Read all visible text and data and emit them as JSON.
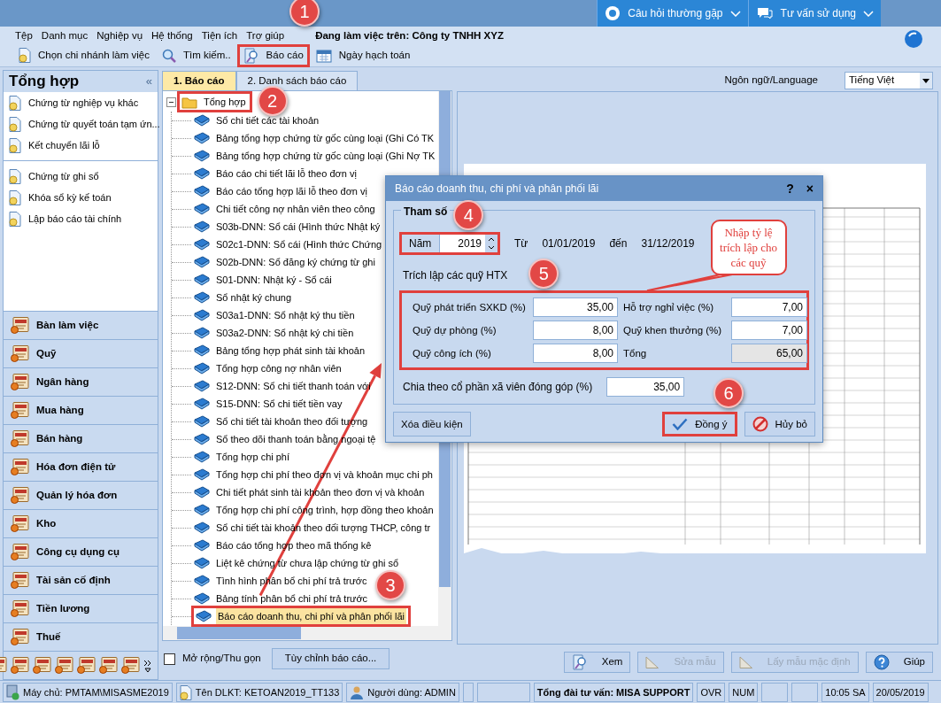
{
  "title_bar": {
    "buttons": [
      {
        "label": "Câu hỏi thường gặp"
      },
      {
        "label": "Tư vấn sử dụng"
      }
    ]
  },
  "menu": {
    "items": [
      "Tệp",
      "Danh mục",
      "Nghiệp vụ",
      "Hệ thống",
      "Tiện ích",
      "Trợ giúp"
    ],
    "working_on": "Đang làm việc trên:  Công ty TNHH XYZ"
  },
  "toolbar": {
    "items": [
      {
        "label": "Chọn chi nhánh làm việc",
        "highlighted": false
      },
      {
        "label": "Tìm kiếm..",
        "highlighted": false
      },
      {
        "label": "Báo cáo",
        "highlighted": true
      },
      {
        "label": "Ngày hạch toán",
        "highlighted": false
      }
    ]
  },
  "sidebar": {
    "title": "Tổng hợp",
    "collapse_glyph": "«",
    "item_groups": [
      {
        "items": [
          "Chứng từ nghiệp vụ khác",
          "Chứng từ quyết toán tạm ứn...",
          "Kết chuyển lãi lỗ"
        ]
      },
      {
        "items": [
          "Chứng từ ghi sổ",
          "Khóa sổ kỳ kế toán",
          "Lập báo cáo tài chính"
        ]
      }
    ],
    "modules": [
      "Bàn làm việc",
      "Quỹ",
      "Ngân hàng",
      "Mua hàng",
      "Bán hàng",
      "Hóa đơn điện tử",
      "Quản lý hóa đơn",
      "Kho",
      "Công cụ dụng cụ",
      "Tài sản cố định",
      "Tiền lương",
      "Thuế"
    ]
  },
  "tabs": [
    {
      "label": "1. Báo cáo",
      "selected": true
    },
    {
      "label": "2. Danh sách báo cáo",
      "selected": false
    }
  ],
  "tree": {
    "label": "Tổng hợp",
    "expanded": true,
    "highlighted": true,
    "children": [
      {
        "label": "Sổ chi tiết các tài khoản",
        "selected": false,
        "highlighted": false
      },
      {
        "label": "Bảng tổng hợp chứng từ gốc cùng loại (Ghi Có TK",
        "selected": false,
        "highlighted": false
      },
      {
        "label": "Bảng tổng hợp chứng từ gốc cùng loại (Ghi Nợ TK",
        "selected": false,
        "highlighted": false
      },
      {
        "label": "Báo cáo chi tiết lãi lỗ theo đơn vị",
        "selected": false,
        "highlighted": false
      },
      {
        "label": "Báo cáo tổng hợp lãi lỗ theo đơn vị",
        "selected": false,
        "highlighted": false
      },
      {
        "label": "Chi tiết công nợ nhân viên theo công",
        "selected": false,
        "highlighted": false
      },
      {
        "label": "S03b-DNN: Sổ cái (Hình thức Nhật ký",
        "selected": false,
        "highlighted": false
      },
      {
        "label": "S02c1-DNN: Sổ cái (Hình thức Chứng",
        "selected": false,
        "highlighted": false
      },
      {
        "label": "S02b-DNN: Sổ đăng ký chứng từ ghi",
        "selected": false,
        "highlighted": false
      },
      {
        "label": "S01-DNN: Nhật ký - Sổ cái",
        "selected": false,
        "highlighted": false
      },
      {
        "label": "Sổ nhật ký chung",
        "selected": false,
        "highlighted": false
      },
      {
        "label": "S03a1-DNN: Sổ nhật ký thu tiền",
        "selected": false,
        "highlighted": false
      },
      {
        "label": "S03a2-DNN: Sổ nhật ký chi tiền",
        "selected": false,
        "highlighted": false
      },
      {
        "label": "Bảng tổng hợp phát sinh tài khoản",
        "selected": false,
        "highlighted": false
      },
      {
        "label": "Tổng hợp công nợ nhân viên",
        "selected": false,
        "highlighted": false
      },
      {
        "label": "S12-DNN: Sổ chi tiết thanh toán với",
        "selected": false,
        "highlighted": false
      },
      {
        "label": "S15-DNN: Sổ chi tiết tiền vay",
        "selected": false,
        "highlighted": false
      },
      {
        "label": "Sổ chi tiết tài khoản theo đối tượng",
        "selected": false,
        "highlighted": false
      },
      {
        "label": "Sổ theo dõi thanh toán bằng ngoại tệ",
        "selected": false,
        "highlighted": false
      },
      {
        "label": "Tổng hợp chi phí",
        "selected": false,
        "highlighted": false
      },
      {
        "label": "Tổng hợp chi phí theo đơn vị và khoản mục chi ph",
        "selected": false,
        "highlighted": false
      },
      {
        "label": "Chi tiết phát sinh tài khoản theo đơn vị và khoản",
        "selected": false,
        "highlighted": false
      },
      {
        "label": "Tổng hợp chi phí công trình, hợp đồng theo khoản",
        "selected": false,
        "highlighted": false
      },
      {
        "label": "Sổ chi tiết tài khoản theo đối tượng THCP, công tr",
        "selected": false,
        "highlighted": false
      },
      {
        "label": "Báo cáo tổng hợp theo mã thống kê",
        "selected": false,
        "highlighted": false
      },
      {
        "label": "Liệt kê chứng từ chưa lập chứng từ ghi sổ",
        "selected": false,
        "highlighted": false
      },
      {
        "label": "Tình hình phân bổ chi phí trả trước",
        "selected": false,
        "highlighted": false
      },
      {
        "label": "Bảng tính phân bổ chi phí trả trước",
        "selected": false,
        "highlighted": false
      },
      {
        "label": "Báo cáo doanh thu, chi phí và phân phối lãi",
        "selected": true,
        "highlighted": true
      }
    ]
  },
  "expand_toggle": {
    "label": "Mở rộng/Thu gọn",
    "checked": false
  },
  "customize_button": "Tùy chỉnh báo cáo...",
  "language": {
    "label": "Ngôn ngữ/Language",
    "value": "Tiếng Việt"
  },
  "preview_buttons": [
    {
      "label": "Xem",
      "disabled": false
    },
    {
      "label": "Sửa mẫu",
      "disabled": true
    },
    {
      "label": "Lấy mẫu mặc định",
      "disabled": true
    },
    {
      "label": "Giúp",
      "disabled": false
    }
  ],
  "dialog": {
    "title": "Báo cáo doanh thu, chi phí và phân phối lãi",
    "help_glyph": "?",
    "close_glyph": "×",
    "group_title": "Tham số",
    "year_label": "Năm",
    "year": "2019",
    "year_highlighted": true,
    "from_label": "Từ",
    "from": "01/01/2019",
    "to_label": "đến",
    "to": "31/12/2019",
    "section": "Trích lập các quỹ HTX",
    "funds_highlighted": true,
    "funds": [
      {
        "label": "Quỹ phát triển SXKD (%)",
        "value": "35,00",
        "readonly": false
      },
      {
        "label": "Hỗ trợ nghỉ việc (%)",
        "value": "7,00",
        "readonly": false
      },
      {
        "label": "Quỹ dự phòng (%)",
        "value": "8,00",
        "readonly": false
      },
      {
        "label": "Quỹ khen thưởng (%)",
        "value": "7,00",
        "readonly": false
      },
      {
        "label": "Quỹ công ích (%)",
        "value": "8,00",
        "readonly": false
      },
      {
        "label": "Tổng",
        "value": "65,00",
        "readonly": true
      }
    ],
    "share_label": "Chia theo cổ phần xã viên đóng góp (%)",
    "share_value": "35,00",
    "clear_button": "Xóa điều kiện",
    "ok_button": "Đồng ý",
    "ok_highlighted": true,
    "cancel_button": "Hủy bỏ"
  },
  "status_bar": [
    {
      "text": "Máy chủ: PMTAM\\MISASME2019",
      "emphasis": false
    },
    {
      "text": "Tên DLKT: KETOAN2019_TT133",
      "emphasis": false
    },
    {
      "text": "Người dùng: ADMIN",
      "emphasis": false
    },
    {
      "text": "Tổng đài tư vấn: MISA SUPPORT",
      "emphasis": true
    },
    {
      "text": "OVR",
      "emphasis": false
    },
    {
      "text": "NUM",
      "emphasis": false
    },
    {
      "text": "10:05 SA",
      "emphasis": false
    },
    {
      "text": "20/05/2019",
      "emphasis": false
    }
  ],
  "annotations": {
    "steps": [
      "1",
      "2",
      "3",
      "4",
      "5",
      "6"
    ],
    "callout": "Nhập tỷ lệ trích lập cho các quỹ"
  }
}
